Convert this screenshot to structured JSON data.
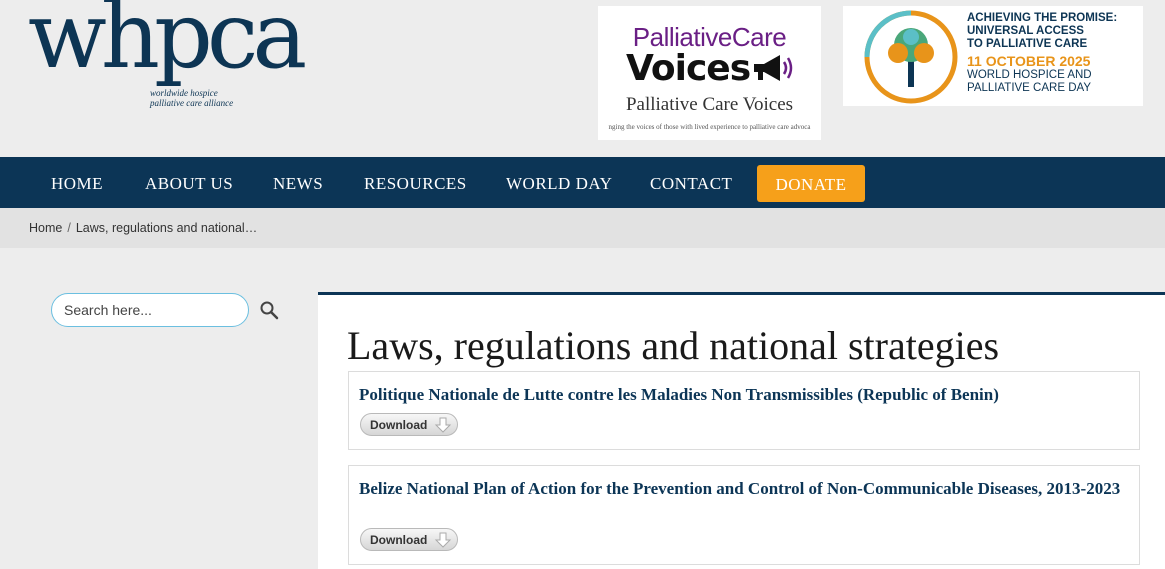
{
  "header": {
    "logo": {
      "wordmark": "whpca",
      "tagline": "worldwide hospice\npalliative care alliance"
    },
    "banner_voices": {
      "top": "PalliativeCare",
      "voices": "Voices",
      "subtitle": "Palliative Care Voices",
      "tiny": "nging the voices of those with lived experience to palliative care advoca",
      "icon": "megaphone-icon"
    },
    "banner_world_day": {
      "line1": "ACHIEVING THE PROMISE:",
      "line2": "UNIVERSAL ACCESS",
      "line3": "TO PALLIATIVE CARE",
      "date": "11 OCTOBER 2025",
      "line5": "WORLD HOSPICE AND",
      "line6": "PALLIATIVE CARE DAY",
      "icon": "tree-icon"
    }
  },
  "nav": {
    "items": [
      {
        "label": "HOME"
      },
      {
        "label": "ABOUT US"
      },
      {
        "label": "NEWS"
      },
      {
        "label": "RESOURCES"
      },
      {
        "label": "WORLD DAY"
      },
      {
        "label": "CONTACT"
      }
    ],
    "donate": "DONATE"
  },
  "breadcrumb": {
    "home": "Home",
    "separator": "/",
    "current": "Laws, regulations and national…"
  },
  "sidebar": {
    "search_placeholder": "Search here...",
    "search_icon": "search-icon"
  },
  "main": {
    "title": "Laws, regulations and national strategies",
    "documents": [
      {
        "title": "Politique Nationale de Lutte contre les Maladies Non Transmissibles (Republic of Benin)",
        "button": "Download"
      },
      {
        "title": "Belize National Plan of Action for the Prevention and Control of Non-Communicable Diseases, 2013-2023",
        "button": "Download"
      }
    ]
  },
  "colors": {
    "navy": "#0c3556",
    "donate": "#f6a01a",
    "background": "#ededed"
  }
}
